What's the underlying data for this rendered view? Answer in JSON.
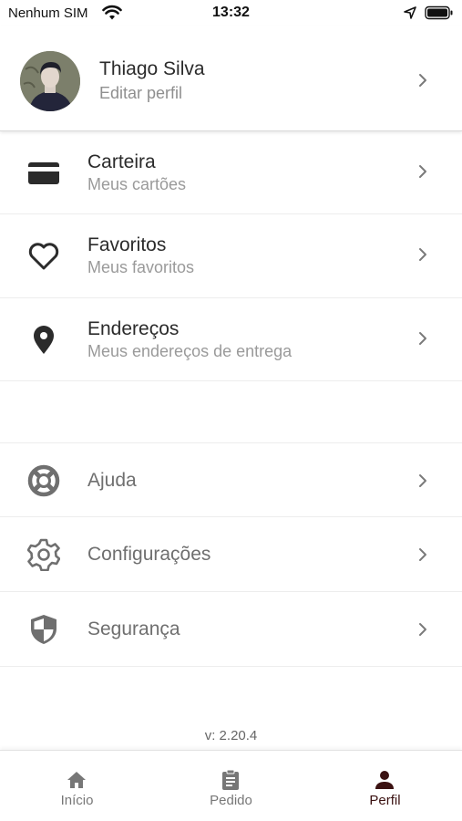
{
  "status_bar": {
    "carrier": "Nenhum SIM",
    "time": "13:32"
  },
  "profile": {
    "name": "Thiago Silva",
    "subtitle": "Editar perfil"
  },
  "menu_primary": [
    {
      "title": "Carteira",
      "subtitle": "Meus cartões",
      "icon": "card-icon"
    },
    {
      "title": "Favoritos",
      "subtitle": "Meus favoritos",
      "icon": "heart-icon"
    },
    {
      "title": "Endereços",
      "subtitle": "Meus endereços de entrega",
      "icon": "location-pin-icon"
    }
  ],
  "menu_secondary": [
    {
      "title": "Ajuda",
      "icon": "lifebuoy-icon"
    },
    {
      "title": "Configurações",
      "icon": "gear-icon"
    },
    {
      "title": "Segurança",
      "icon": "shield-icon"
    }
  ],
  "version": "v: 2.20.4",
  "tabs": [
    {
      "label": "Início",
      "icon": "home-icon",
      "active": false
    },
    {
      "label": "Pedido",
      "icon": "clipboard-icon",
      "active": false
    },
    {
      "label": "Perfil",
      "icon": "person-icon",
      "active": true
    }
  ],
  "colors": {
    "active_tab": "#3b1212",
    "inactive_tab": "#777777",
    "icon_dark": "#2b2b2b",
    "icon_gray": "#6f6f6f"
  }
}
